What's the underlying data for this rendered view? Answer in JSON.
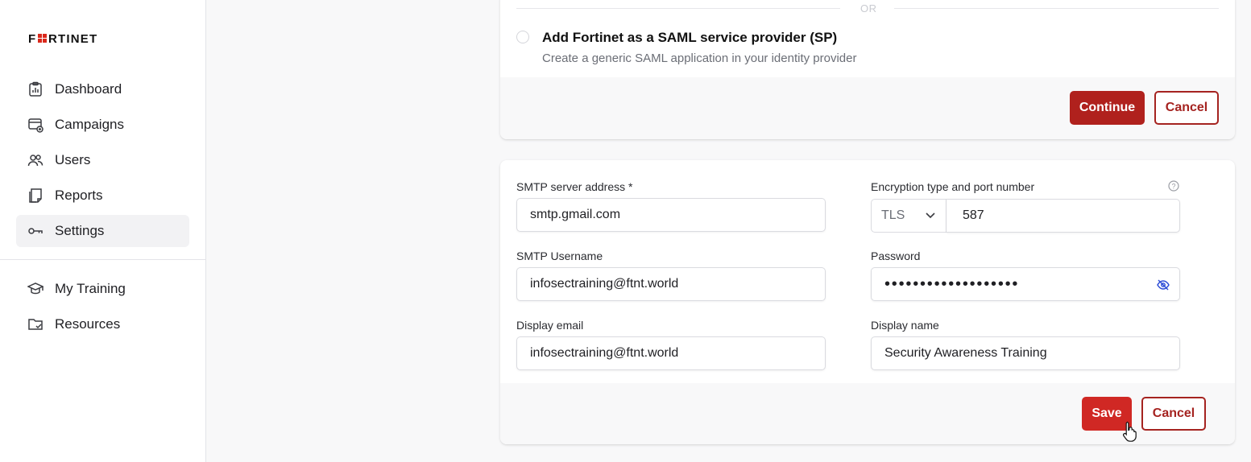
{
  "brand": {
    "logo_text_a": "F",
    "logo_text_b": "RTINET",
    "logo_accent": "#da291c"
  },
  "sidebar": {
    "items": [
      {
        "label": "Dashboard",
        "icon": "dashboard-icon"
      },
      {
        "label": "Campaigns",
        "icon": "campaigns-icon"
      },
      {
        "label": "Users",
        "icon": "users-icon"
      },
      {
        "label": "Reports",
        "icon": "reports-icon"
      },
      {
        "label": "Settings",
        "icon": "key-icon",
        "active": true
      }
    ],
    "items2": [
      {
        "label": "My Training",
        "icon": "graduation-cap-icon"
      },
      {
        "label": "Resources",
        "icon": "folder-check-icon"
      }
    ]
  },
  "saml_card": {
    "or_text": "OR",
    "option_title": "Add Fortinet as a SAML service provider (SP)",
    "option_subtitle": "Create a generic SAML application in your identity provider",
    "continue_label": "Continue",
    "cancel_label": "Cancel"
  },
  "smtp_card": {
    "server_label": "SMTP server address *",
    "server_value": "smtp.gmail.com",
    "encryption_label": "Encryption type and port number",
    "encryption_value": "TLS",
    "port_value": "587",
    "username_label": "SMTP Username",
    "username_value": "infosectraining@ftnt.world",
    "password_label": "Password",
    "password_value": "•••••••••••••••••••",
    "display_email_label": "Display email",
    "display_email_value": "infosectraining@ftnt.world",
    "display_name_label": "Display name",
    "display_name_value": "Security Awareness Training",
    "save_label": "Save",
    "cancel_label": "Cancel"
  },
  "colors": {
    "primary": "#b0211d",
    "primary_bright": "#d02824",
    "active_bg": "#f2f2f4"
  }
}
